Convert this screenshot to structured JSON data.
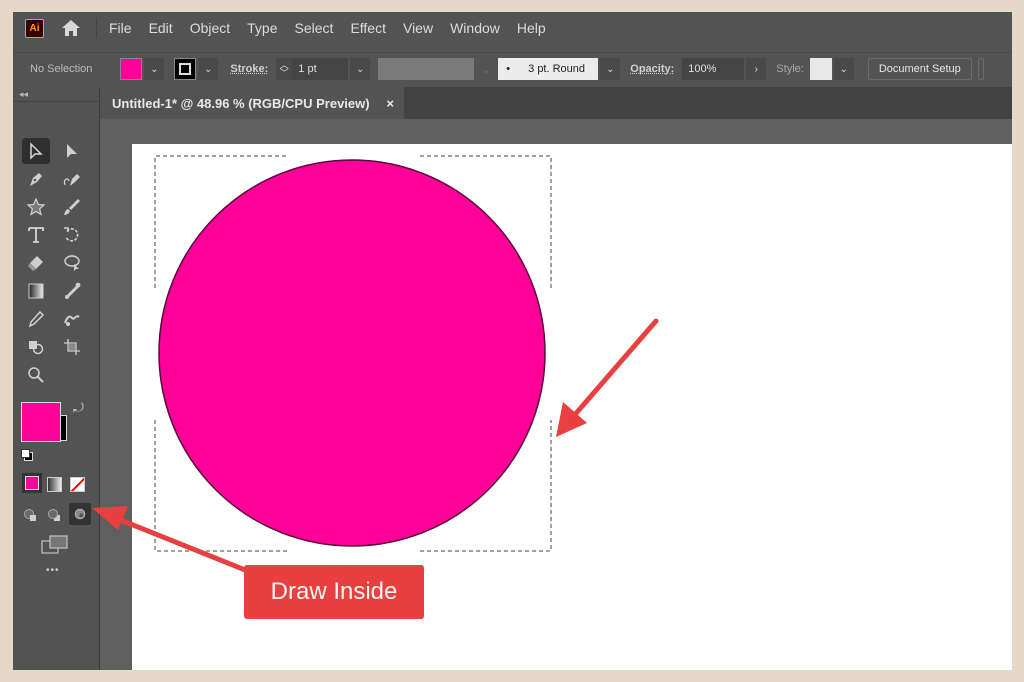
{
  "menubar": {
    "logo": "Ai",
    "items": [
      "File",
      "Edit",
      "Object",
      "Type",
      "Select",
      "Effect",
      "View",
      "Window",
      "Help"
    ]
  },
  "control_bar": {
    "selection_status": "No Selection",
    "fill_color": "#ff0099",
    "stroke_label": "Stroke:",
    "stroke_weight": "1 pt",
    "brush_profile": "3 pt. Round",
    "opacity_label": "Opacity:",
    "opacity_value": "100%",
    "style_label": "Style:",
    "document_setup_label": "Document Setup"
  },
  "document_tab": {
    "title": "Untitled-1* @ 48.96 % (RGB/CPU Preview)",
    "close_glyph": "×"
  },
  "toolbar": {
    "collapse_glyph": "◂◂",
    "tools": [
      "selection-tool",
      "direct-selection-tool",
      "pen-tool",
      "curvature-tool",
      "star-tool",
      "paintbrush-tool",
      "type-tool",
      "rotate-tool",
      "eraser-tool",
      "lasso-tool",
      "gradient-tool",
      "puppet-warp-tool",
      "eyedropper-tool",
      "blend-tool",
      "shape-builder-tool",
      "artboard-tool",
      "zoom-tool"
    ],
    "fill_color": "#ff0099",
    "stroke_color": "#000000",
    "draw_modes": [
      "Draw Normal",
      "Draw Behind",
      "Draw Inside"
    ],
    "active_draw_mode": "Draw Inside",
    "more_glyph": "•••"
  },
  "artwork": {
    "shape": "circle",
    "fill": "#ff0099",
    "stroke": "#5a0a3a"
  },
  "annotation": {
    "callout_text": "Draw Inside",
    "arrow_color": "#e84040"
  }
}
